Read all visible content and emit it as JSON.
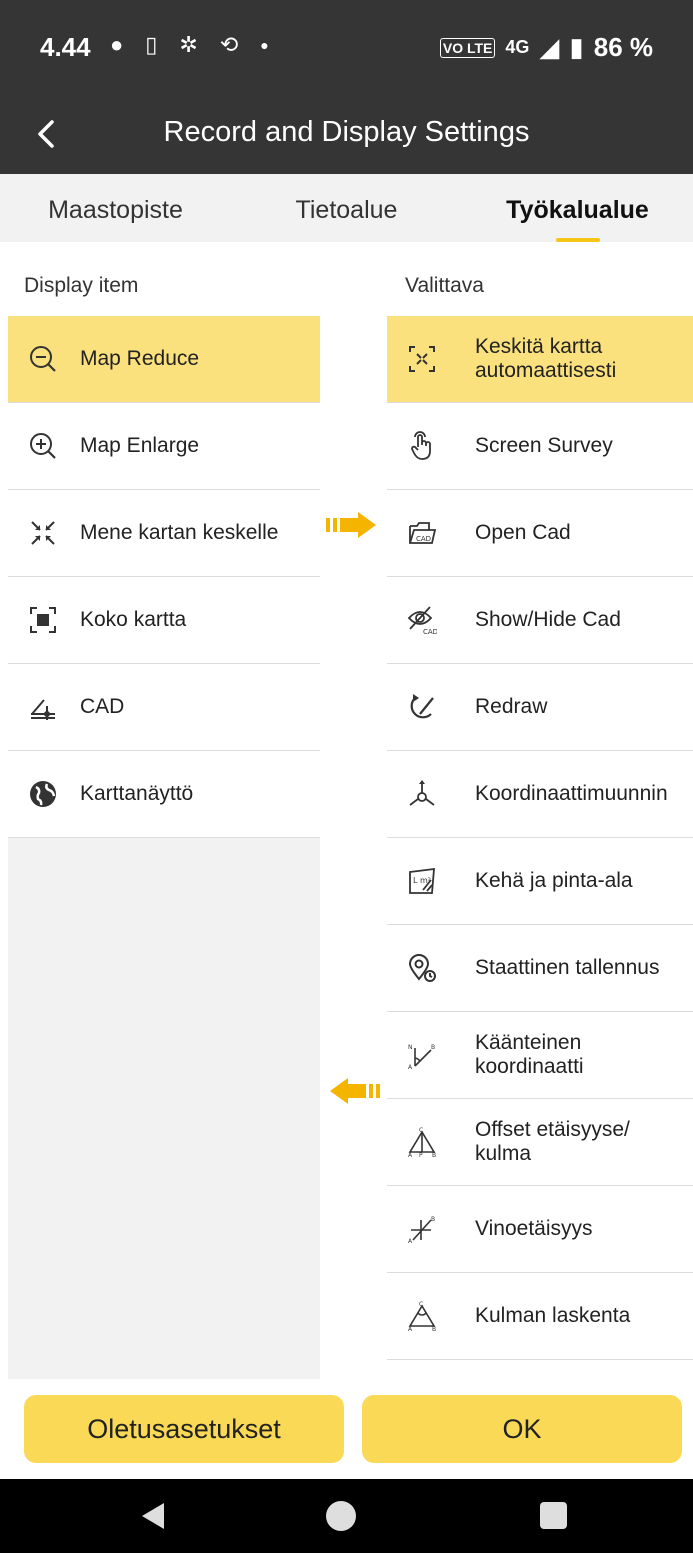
{
  "status_bar": {
    "time": "4.44",
    "volte": "VO LTE",
    "network": "4G",
    "battery": "86 %"
  },
  "app_bar": {
    "title": "Record and Display Settings"
  },
  "tabs": [
    {
      "label": "Maastopiste",
      "active": false
    },
    {
      "label": "Tietoalue",
      "active": false
    },
    {
      "label": "Työkalualue",
      "active": true
    }
  ],
  "left_column": {
    "header": "Display item",
    "items": [
      {
        "label": "Map Reduce",
        "icon": "zoom-out-icon",
        "selected": true
      },
      {
        "label": "Map Enlarge",
        "icon": "zoom-in-icon",
        "selected": false
      },
      {
        "label": "Mene kartan keskelle",
        "icon": "center-arrows-icon",
        "selected": false
      },
      {
        "label": "Koko kartta",
        "icon": "full-map-icon",
        "selected": false
      },
      {
        "label": "CAD",
        "icon": "cad-draw-icon",
        "selected": false
      },
      {
        "label": "Karttanäyttö",
        "icon": "globe-icon",
        "selected": false
      }
    ]
  },
  "right_column": {
    "header": "Valittava",
    "items": [
      {
        "label": "Keskitä kartta automaattisesti",
        "icon": "auto-center-icon",
        "selected": true
      },
      {
        "label": "Screen Survey",
        "icon": "hand-pointer-icon",
        "selected": false
      },
      {
        "label": "Open Cad",
        "icon": "folder-cad-icon",
        "selected": false
      },
      {
        "label": "Show/Hide Cad",
        "icon": "eye-hide-icon",
        "selected": false
      },
      {
        "label": "Redraw",
        "icon": "redraw-icon",
        "selected": false
      },
      {
        "label": "Koordinaattimuunnin",
        "icon": "coordinate-transform-icon",
        "selected": false
      },
      {
        "label": "Kehä ja pinta-ala",
        "icon": "area-icon",
        "selected": false
      },
      {
        "label": "Staattinen tallennus",
        "icon": "static-location-icon",
        "selected": false
      },
      {
        "label": "Käänteinen koordinaatti",
        "icon": "inverse-coordinate-icon",
        "selected": false
      },
      {
        "label": "Offset etäisyyse/ kulma",
        "icon": "offset-triangle-icon",
        "selected": false
      },
      {
        "label": "Vinoetäisyys",
        "icon": "slope-distance-icon",
        "selected": false
      },
      {
        "label": "Kulman laskenta",
        "icon": "angle-calc-icon",
        "selected": false
      }
    ]
  },
  "buttons": {
    "default_label": "Oletusasetukset",
    "ok_label": "OK"
  },
  "colors": {
    "accent": "#f5c518",
    "selected_row": "#fae17e",
    "button": "#f9d955",
    "header_bg": "#353535"
  }
}
